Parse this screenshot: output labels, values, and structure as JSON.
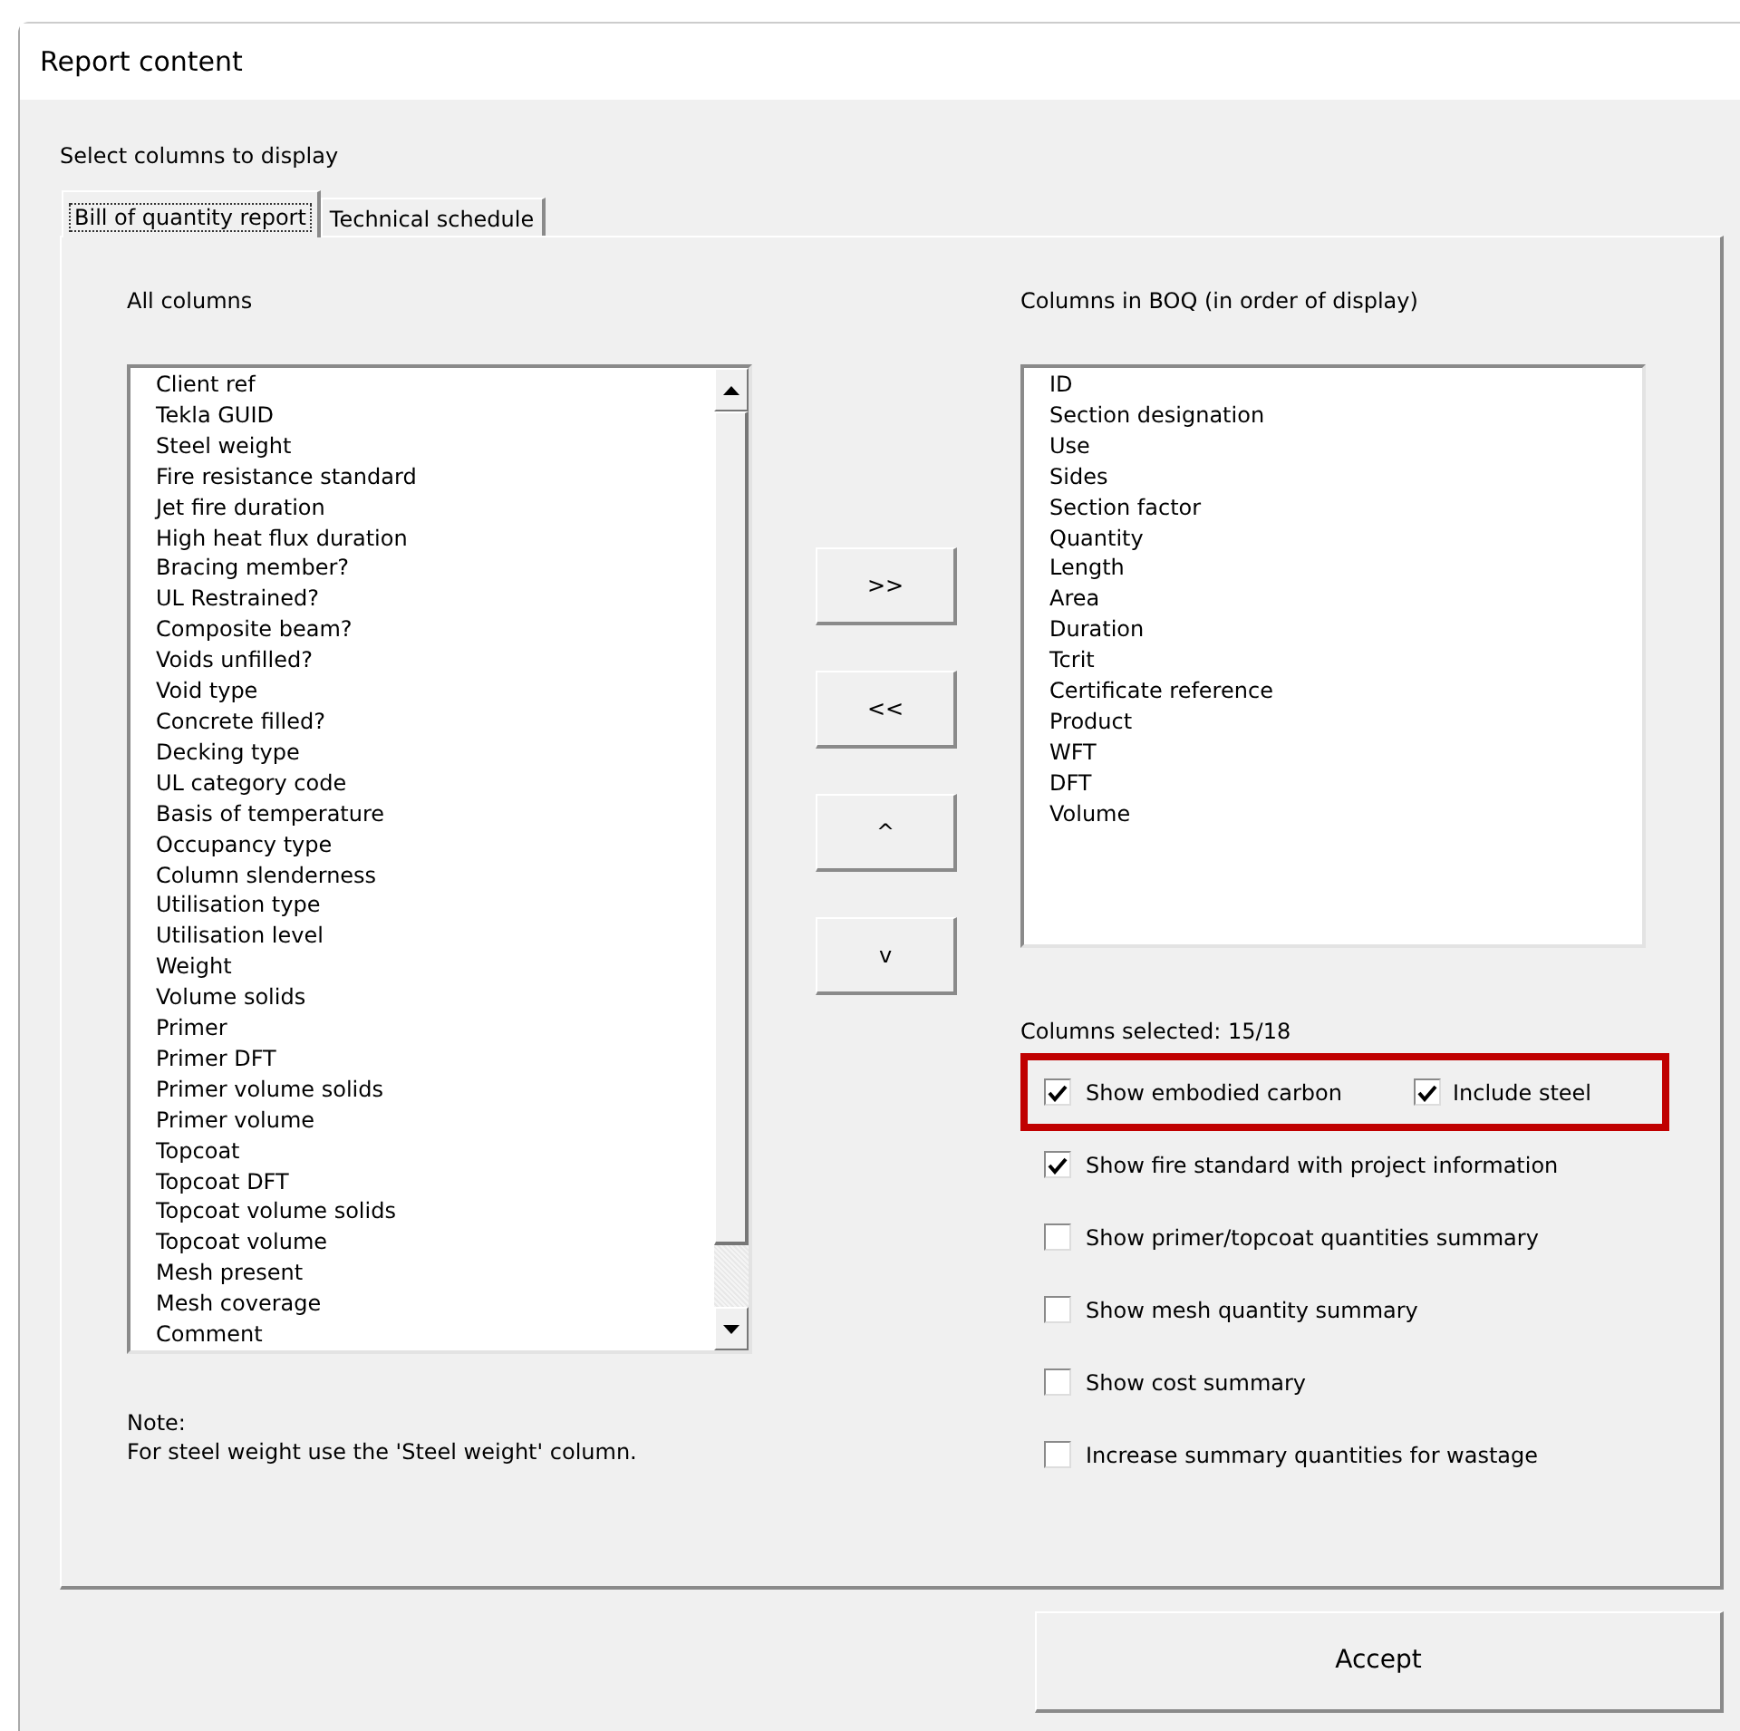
{
  "window": {
    "title": "Report content"
  },
  "heading": "Select columns to display",
  "tabs": [
    {
      "label": "Bill of quantity report",
      "selected": true
    },
    {
      "label": "Technical schedule",
      "selected": false
    }
  ],
  "all_columns": {
    "label": "All columns",
    "items": [
      "Client ref",
      "Tekla GUID",
      "Steel weight",
      "Fire resistance standard",
      "Jet fire duration",
      "High heat flux duration",
      "Bracing member?",
      "UL Restrained?",
      "Composite beam?",
      "Voids unfilled?",
      "Void type",
      "Concrete filled?",
      "Decking type",
      "UL category code",
      "Basis of temperature",
      "Occupancy type",
      "Column slenderness",
      "Utilisation type",
      "Utilisation level",
      "Weight",
      "Volume solids",
      "Primer",
      "Primer DFT",
      "Primer volume solids",
      "Primer volume",
      "Topcoat",
      "Topcoat DFT",
      "Topcoat volume solids",
      "Topcoat volume",
      "Mesh present",
      "Mesh coverage",
      "Comment"
    ]
  },
  "move_buttons": [
    ">>",
    "<<",
    "^",
    "v"
  ],
  "boq_columns": {
    "label": "Columns in BOQ (in order of display)",
    "items": [
      "ID",
      "Section designation",
      "Use",
      "Sides",
      "Section factor",
      "Quantity",
      "Length",
      "Area",
      "Duration",
      "Tcrit",
      "Certificate reference",
      "Product",
      "WFT",
      "DFT",
      "Volume"
    ]
  },
  "columns_selected": "Columns selected: 15/18",
  "options": [
    {
      "highlighted": true,
      "checkboxes": [
        {
          "label": "Show embodied carbon",
          "checked": true
        },
        {
          "label": "Include steel",
          "checked": true
        }
      ]
    },
    {
      "highlighted": false,
      "checkboxes": [
        {
          "label": "Show fire standard with project information",
          "checked": true
        }
      ]
    },
    {
      "highlighted": false,
      "checkboxes": [
        {
          "label": "Show primer/topcoat quantities summary",
          "checked": false
        }
      ]
    },
    {
      "highlighted": false,
      "checkboxes": [
        {
          "label": "Show mesh quantity summary",
          "checked": false
        }
      ]
    },
    {
      "highlighted": false,
      "checkboxes": [
        {
          "label": "Show cost summary",
          "checked": false
        }
      ]
    },
    {
      "highlighted": false,
      "checkboxes": [
        {
          "label": "Increase summary quantities for wastage",
          "checked": false
        }
      ]
    }
  ],
  "note": {
    "title": "Note:",
    "text": "For steel weight use the 'Steel weight' column."
  },
  "accept_button": "Accept"
}
